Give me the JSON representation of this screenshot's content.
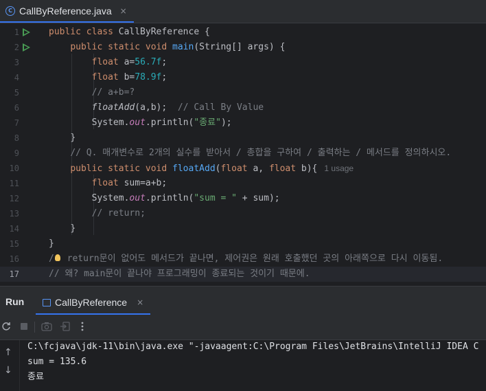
{
  "editor_tab": {
    "title": "CallByReference.java",
    "icon": "java-class-icon",
    "close": "×"
  },
  "lines": [
    {
      "n": "1",
      "run": true
    },
    {
      "n": "2",
      "run": true
    },
    {
      "n": "3"
    },
    {
      "n": "4"
    },
    {
      "n": "5"
    },
    {
      "n": "6"
    },
    {
      "n": "7"
    },
    {
      "n": "8"
    },
    {
      "n": "9"
    },
    {
      "n": "10"
    },
    {
      "n": "11"
    },
    {
      "n": "12"
    },
    {
      "n": "13"
    },
    {
      "n": "14"
    },
    {
      "n": "15"
    },
    {
      "n": "16"
    },
    {
      "n": "17",
      "current": true
    }
  ],
  "code": {
    "l1_kw": "public class",
    "l1_rest": " CallByReference {",
    "l2_kw": "public static void",
    "l2_fn": "main",
    "l2_rest": "(String[] args) {",
    "l3_kw": "float",
    "l3_a": " a=",
    "l3_num": "56.7f",
    "l3_end": ";",
    "l4_kw": "float",
    "l4_a": " b=",
    "l4_num": "78.9f",
    "l4_end": ";",
    "l5_cm": "// a+b=?",
    "l6_fn": "floatAdd",
    "l6_rest": "(a,b);  ",
    "l6_cm": "// Call By Value",
    "l7_a": "System.",
    "l7_out": "out",
    "l7_b": ".println(",
    "l7_str": "\"종료\"",
    "l7_end": ");",
    "l8": "}",
    "l9_cm": "// Q. 매개변수로 2개의 실수를 받아서 / 총합을 구하여 / 출력하는 / 메서드를 정의하시오.",
    "l10_kw": "public static void",
    "l10_fn": "floatAdd",
    "l10_p1": "(",
    "l10_k1": "float",
    "l10_p2": " a, ",
    "l10_k2": "float",
    "l10_p3": " b){",
    "l10_usage": "1 usage",
    "l11_kw": "float",
    "l11_rest": " sum=a+b;",
    "l12_a": "System.",
    "l12_out": "out",
    "l12_b": ".println(",
    "l12_str": "\"sum = \"",
    "l12_end": " + sum);",
    "l13_cm": "// return;",
    "l14": "}",
    "l15": "}",
    "l16_a": "/",
    "l16_b": " return문이 없어도 메서드가 끝나면, 제어권은 원래 호출했던 곳의 아래쪽으로 다시 이동됨.",
    "l17_cm": "// 왜? main문이 끝나야 프로그래밍이 종료되는 것이기 때문에."
  },
  "run_panel": {
    "title": "Run",
    "tab_label": "CallByReference",
    "close": "×"
  },
  "toolbar_icons": [
    "rerun-icon",
    "stop-icon",
    "camera-icon",
    "exit-icon",
    "more-icon"
  ],
  "console": {
    "lines": [
      "C:\\fcjava\\jdk-11\\bin\\java.exe \"-javaagent:C:\\Program Files\\JetBrains\\IntelliJ IDEA C",
      "sum = 135.6",
      "종료"
    ]
  },
  "colors": {
    "keyword": "#cf8e6d",
    "function": "#56a8f5",
    "number": "#2aacb8",
    "string": "#6aab73",
    "comment": "#7a7e85",
    "static_field": "#c77dbb",
    "accent": "#3574f0"
  }
}
